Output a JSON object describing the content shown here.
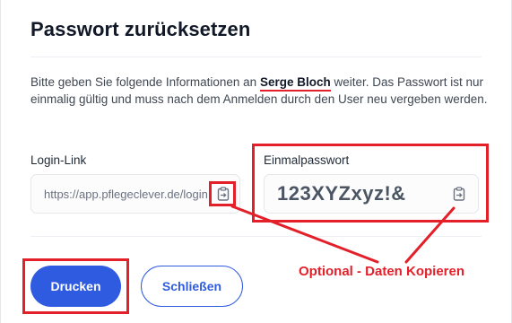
{
  "dialog": {
    "title": "Passwort zurücksetzen",
    "description_before": "Bitte geben Sie folgende Informationen an ",
    "user_name": "Serge Bloch",
    "description_after": " weiter. Das Passwort ist nur einmalig gültig und muss nach dem Anmelden durch den User neu vergeben werden."
  },
  "login_link": {
    "label": "Login-Link",
    "value": "https://app.pflegeclever.de/login",
    "copy_icon": "clipboard-copy-icon"
  },
  "one_time_password": {
    "label": "Einmalpasswort",
    "value": "123XYZxyz!&",
    "copy_icon": "clipboard-copy-icon"
  },
  "buttons": {
    "print_label": "Drucken",
    "close_label": "Schließen"
  },
  "annotation": {
    "text": "Optional - Daten Kopieren",
    "color": "#e3202a"
  },
  "colors": {
    "primary": "#2f5be0",
    "highlight_red": "#e3202a",
    "text_dark": "#111827",
    "text_muted": "#3f4752"
  }
}
